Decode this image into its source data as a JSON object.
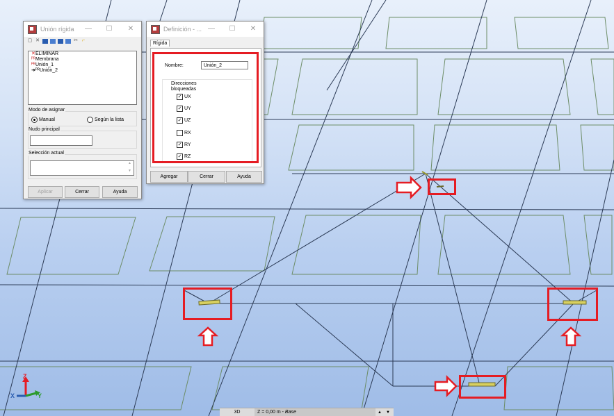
{
  "main_window": {
    "title": "Unión rígida",
    "list_items": [
      {
        "label": "ELIMINAR",
        "marker": "✕",
        "marker_color": "#d71d1d"
      },
      {
        "label": "Membrana",
        "marker": "ᴾᴿ",
        "marker_color": "#c33"
      },
      {
        "label": "Unión_1",
        "marker": "ᴾᴿ",
        "marker_color": "#c33"
      },
      {
        "label": "Unión_2",
        "marker": "➜ᴾᴿ",
        "marker_color": "#000"
      }
    ],
    "assign_group_label": "Modo de asignar",
    "assign_options": {
      "manual": "Manual",
      "list": "Según la lista",
      "selected": "manual"
    },
    "main_node_label": "Nudo principal",
    "main_node_value": "",
    "selection_label": "Selección actual",
    "selection_value": "",
    "buttons": {
      "apply": "Aplicar",
      "close": "Cerrar",
      "help": "Ayuda"
    }
  },
  "definition_window": {
    "title": "Definición - ...",
    "tab": "Rígida",
    "name_label": "Nombre:",
    "name_value": "Unión_2",
    "directions_label": "Direcciones bloqueadas",
    "directions": [
      {
        "label": "UX",
        "checked": true
      },
      {
        "label": "UY",
        "checked": true
      },
      {
        "label": "UZ",
        "checked": true
      },
      {
        "label": "RX",
        "checked": false
      },
      {
        "label": "RY",
        "checked": true
      },
      {
        "label": "RZ",
        "checked": true
      }
    ],
    "buttons": {
      "add": "Agregar",
      "close": "Cerrar",
      "help": "Ayuda"
    }
  },
  "axes": {
    "z": "Z",
    "x": "X",
    "y": "Y"
  },
  "status_bar": {
    "view": "3D",
    "level_prefix": "Z = 0,00 m -",
    "level_name": "Base"
  },
  "colors": {
    "highlight": "#e51c23",
    "rigid_link": "#d8d060",
    "grid_line": "#2b3a55",
    "panel_line": "#5d8a5a"
  }
}
